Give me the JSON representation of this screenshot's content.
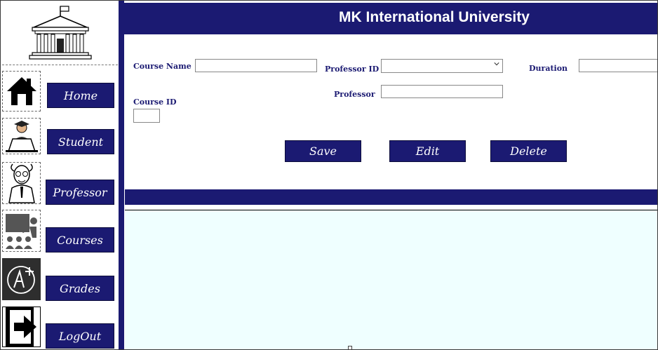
{
  "app": {
    "title": "MK International University"
  },
  "sidebar": {
    "items": [
      {
        "label": "Home",
        "icon": "house-icon"
      },
      {
        "label": "Student",
        "icon": "student-laptop-icon"
      },
      {
        "label": "Professor",
        "icon": "professor-icon"
      },
      {
        "label": "Courses",
        "icon": "classroom-icon"
      },
      {
        "label": "Grades",
        "icon": "grade-a-plus-icon"
      },
      {
        "label": "LogOut",
        "icon": "logout-icon"
      }
    ]
  },
  "form": {
    "course_name_label": "Course Name",
    "course_name_value": "",
    "professor_id_label": "Professor ID",
    "professor_id_value": "",
    "duration_label": "Duration",
    "duration_value": "",
    "professor_label": "Professor",
    "professor_value": "",
    "course_id_label": "Course ID",
    "course_id_value": ""
  },
  "actions": {
    "save": "Save",
    "edit": "Edit",
    "delete": "Delete"
  },
  "colors": {
    "accent": "#1b1a72",
    "grid_background": "#efffff"
  }
}
